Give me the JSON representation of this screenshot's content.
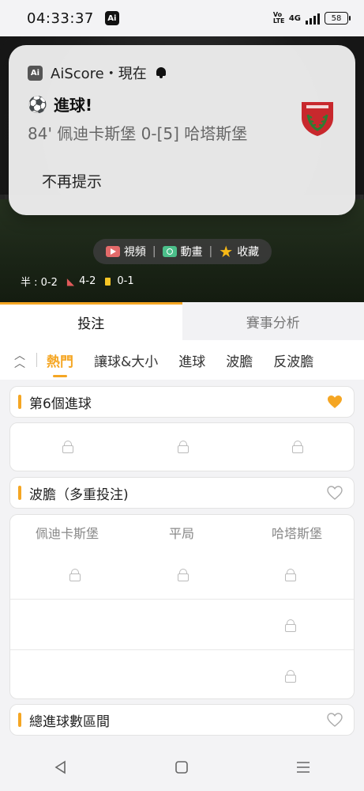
{
  "status_bar": {
    "time": "04:33:37",
    "ai_badge": "Ai",
    "volte": "Vo LTE",
    "network": "4G",
    "battery": "58"
  },
  "notification": {
    "app_icon_text": "Ai",
    "header": "AiScore・現在",
    "title": "進球!",
    "body": "84' 佩迪卡斯堡 0-[5] 哈塔斯堡",
    "action": "不再提示",
    "colors": {
      "logo_red": "#c8282d",
      "logo_green": "#2e7d32"
    }
  },
  "hero": {
    "media_bar": {
      "video": "視頻",
      "animation": "動畫",
      "favorite": "收藏"
    },
    "stats": {
      "half": "半 : 0-2",
      "corners": "4-2",
      "cards": "0-1"
    }
  },
  "tabs": {
    "bet": "投注",
    "analysis": "賽事分析"
  },
  "subnav": [
    "熱門",
    "讓球&大小",
    "進球",
    "波膽",
    "反波膽"
  ],
  "sections": {
    "sixth_goal": {
      "title": "第6個進球",
      "favorited": true
    },
    "correct_score": {
      "title": "波膽（多重投注)",
      "favorited": false,
      "columns": [
        "佩迪卡斯堡",
        "平局",
        "哈塔斯堡"
      ]
    },
    "total_goals": {
      "title": "總進球數區間",
      "favorited": false
    }
  },
  "colors": {
    "accent": "#f5a623"
  }
}
